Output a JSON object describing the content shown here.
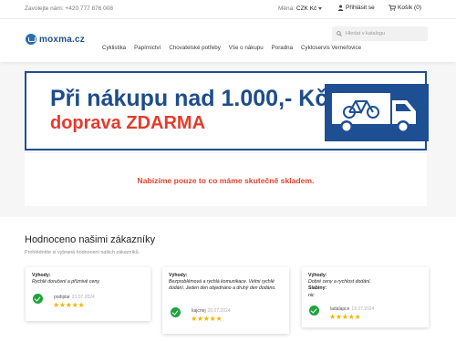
{
  "topbar": {
    "phone": "Zavolejte nám: +420 777 876 008",
    "currency_label": "Měna:",
    "currency_value": "CZK Kč",
    "login": "Přihlásit se",
    "cart": "Košík (0)"
  },
  "header": {
    "logo_text": "moxma.cz",
    "nav": [
      "Cyklistika",
      "Papírnictví",
      "Chovatelské potřeby",
      "Vše o nákupu",
      "Poradna",
      "Cykloservis Verneřovice"
    ],
    "search_placeholder": "Hledat v katalogu"
  },
  "banner": {
    "line1": "Při nákupu nad 1.000,- Kč",
    "line2": "doprava ZDARMA",
    "colors": {
      "blue": "#1d4d8a",
      "red": "#e53b2c"
    }
  },
  "notice": {
    "text": "Nabízíme pouze to co máme skutečně skladem."
  },
  "reviews": {
    "title": "Hodnoceno našimi zákazníky",
    "subtitle": "Prohlédněte si vybraná hodnocení našich zákazníků.",
    "cards": [
      {
        "label": "Výhody:",
        "body": "Rychlé doručení a příznivé ceny.",
        "author": "podiplar",
        "date": "21.07.2024",
        "rating": 5
      },
      {
        "label": "Výhody:",
        "body": "Bezproblémová a rychlá komunikace. Velmi rychlé dodání. Jeden den objednáno a druhý den dodáno.",
        "author": "kajcnej",
        "date": "20.07.2024",
        "rating": 5
      },
      {
        "label": "Výhody:",
        "body": "Dobré ceny a rychlost dodání.",
        "label2": "Slabiny:",
        "body2": "nic",
        "author": "ladalapce",
        "date": "19.07.2024",
        "rating": 5
      }
    ],
    "star_color": "#f4b400",
    "check_color": "#1fa33c"
  }
}
